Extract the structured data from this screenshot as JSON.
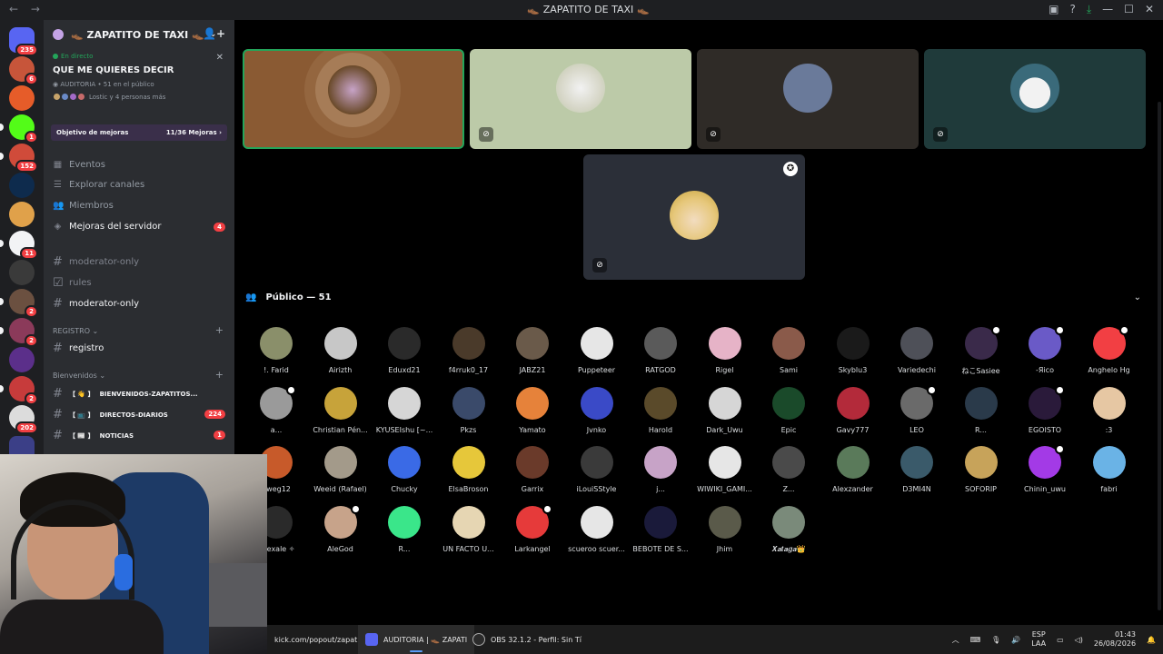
{
  "window": {
    "title": "ZAPATITO DE TAXI",
    "back": "←",
    "forward": "→"
  },
  "rail": {
    "servers": [
      {
        "name": "discord-home",
        "color": "#5865f2",
        "badge": "235"
      },
      {
        "name": "server-2",
        "color": "#c7553a",
        "badge": "6"
      },
      {
        "name": "server-3",
        "color": "#e65c29",
        "badge": ""
      },
      {
        "name": "kick",
        "color": "#53fc18",
        "badge": "1"
      },
      {
        "name": "server-5",
        "color": "#d04b3a",
        "badge": "152"
      },
      {
        "name": "hp-esports",
        "color": "#0e2b4d",
        "badge": ""
      },
      {
        "name": "server-7",
        "color": "#e0a14a",
        "badge": ""
      },
      {
        "name": "server-8",
        "color": "#f2f3f5",
        "badge": "11"
      },
      {
        "name": "server-9",
        "color": "#3a3a3a",
        "badge": ""
      },
      {
        "name": "server-10",
        "color": "#6b5040",
        "badge": "2"
      },
      {
        "name": "server-11",
        "color": "#8b3a5a",
        "badge": "2"
      },
      {
        "name": "server-12",
        "color": "#5b2f8a",
        "badge": ""
      },
      {
        "name": "server-13",
        "color": "#c73b3b",
        "badge": "2"
      },
      {
        "name": "server-14",
        "color": "#dcdcdc",
        "badge": "202"
      },
      {
        "name": "folder",
        "color": "#3b3f87",
        "badge": ""
      }
    ]
  },
  "sidebar": {
    "server_name": "ZAPATITO DE TAXI",
    "live": {
      "tag": "En directo",
      "title": "QUE ME QUIERES DECIR",
      "meta": "AUDITORIA • 51 en el público",
      "people": "Lostic y 4 personas más"
    },
    "boost": {
      "label": "Objetivo de mejoras",
      "progress": "11/36 Mejoras"
    },
    "nav": [
      {
        "label": "Eventos",
        "icon": "calendar-icon"
      },
      {
        "label": "Explorar canales",
        "icon": "explore-icon"
      },
      {
        "label": "Miembros",
        "icon": "members-icon"
      },
      {
        "label": "Mejoras del servidor",
        "icon": "boost-icon",
        "badge": "4"
      }
    ],
    "channels_top": [
      {
        "label": "moderator-only"
      },
      {
        "label": "rules"
      },
      {
        "label": "moderator-only"
      }
    ],
    "category_registro": "REGISTRO",
    "channel_registro": "registro",
    "category_bienvenidos": "Bienvenidos",
    "channels_bottom": [
      {
        "prefix": "【 👋 】",
        "label": "BIENVENIDOS-ZAPATITOS...",
        "badge": ""
      },
      {
        "prefix": "【 📺 】",
        "label": "DIRECTOS-DIARIOS",
        "badge": "224"
      },
      {
        "prefix": "【 📰 】",
        "label": "NOTICIAS",
        "badge": "1"
      }
    ]
  },
  "audience": {
    "title": "Público — 51",
    "members": [
      {
        "name": "!. Farid",
        "color": "#8a8f6a"
      },
      {
        "name": "Airizth",
        "color": "#c7c7c7"
      },
      {
        "name": "Eduxd21",
        "color": "#2a2a2a"
      },
      {
        "name": "f4rruk0_17",
        "color": "#4a3a2a"
      },
      {
        "name": "JABZ21",
        "color": "#6a5a4a"
      },
      {
        "name": "Puppeteer",
        "color": "#e6e6e6"
      },
      {
        "name": "RATGOD",
        "color": "#5a5a5a"
      },
      {
        "name": "Rigel",
        "color": "#e6b3c7"
      },
      {
        "name": "Sami",
        "color": "#8a5a4a"
      },
      {
        "name": "Skyblu3",
        "color": "#1a1a1a"
      },
      {
        "name": "Variedechi",
        "color": "#4e5058"
      },
      {
        "name": "ねこSasiee",
        "color": "#3a2a4a"
      },
      {
        "name": "-Яico",
        "color": "#6a5ac7"
      },
      {
        "name": "Anghelo Hg",
        "color": "#f23f43"
      },
      {
        "name": "a...",
        "color": "#9a9a9a"
      },
      {
        "name": "Christian Pén...",
        "color": "#c7a33a"
      },
      {
        "name": "KYUSEIshu [~...",
        "color": "#d6d6d6"
      },
      {
        "name": "Pkzs",
        "color": "#3a4a6a"
      },
      {
        "name": "Yamato",
        "color": "#e6823a"
      },
      {
        "name": "Jvnko",
        "color": "#3a4ac7"
      },
      {
        "name": "Harold",
        "color": "#5a4a2a"
      },
      {
        "name": "Dark_Uwu",
        "color": "#d6d6d6"
      },
      {
        "name": "Epic",
        "color": "#1a4a2a"
      },
      {
        "name": "Gavy777",
        "color": "#b32a3a"
      },
      {
        "name": "LEO",
        "color": "#6a6a6a"
      },
      {
        "name": "R...",
        "color": "#2a3a4a"
      },
      {
        "name": "EGOISTO",
        "color": "#2a1a3a"
      },
      {
        "name": ":3",
        "color": "#e6c7a3"
      },
      {
        "name": "gweg12",
        "color": "#c75a2a"
      },
      {
        "name": "Weeid (Rafael)",
        "color": "#a39a8a"
      },
      {
        "name": "Chucky",
        "color": "#3a6ae6"
      },
      {
        "name": "ElsaBroson",
        "color": "#e6c73a"
      },
      {
        "name": "Garrix",
        "color": "#6a3a2a"
      },
      {
        "name": "iLouiSStyle",
        "color": "#3a3a3a"
      },
      {
        "name": "j...",
        "color": "#c7a3c7"
      },
      {
        "name": "WIWIKI_GAMI...",
        "color": "#e6e6e6"
      },
      {
        "name": "Z...",
        "color": "#4a4a4a"
      },
      {
        "name": "Alexzander",
        "color": "#5a7a5a"
      },
      {
        "name": "D3MI4N",
        "color": "#3a5a6a"
      },
      {
        "name": "SOFORIP",
        "color": "#c7a35a"
      },
      {
        "name": "Chinin_uwu",
        "color": "#a33ae6"
      },
      {
        "name": "fabri",
        "color": "#6ab3e6"
      },
      {
        "name": "puexale ✧",
        "color": "#2a2a2a"
      },
      {
        "name": "AleGod",
        "color": "#c7a38a"
      },
      {
        "name": "R...",
        "color": "#3ae68a"
      },
      {
        "name": "UN FACTO U...",
        "color": "#e6d6b3"
      },
      {
        "name": "Larkangel",
        "color": "#e63a3a"
      },
      {
        "name": "scueroo scuer...",
        "color": "#e6e6e6"
      },
      {
        "name": "BEBOTE DE S...",
        "color": "#1a1a3a"
      },
      {
        "name": "Jhim",
        "color": "#5a5a4a"
      },
      {
        "name": "𝑿𝒂𝒕𝒂𝒈𝒂👑",
        "color": "#7a8a7a"
      }
    ]
  },
  "taskbar": {
    "items": [
      {
        "label": "kick.com/popout/zapati",
        "icon": "browser-icon"
      },
      {
        "label": "AUDITORIA | 👞 ZAPATI",
        "icon": "discord-icon"
      },
      {
        "label": "OBS 32.1.2 - Perfil: Sin Tí",
        "icon": "obs-icon"
      }
    ],
    "lang_top": "ESP",
    "lang_bottom": "LAA",
    "time": "01:43",
    "date": "26/08/2026"
  },
  "colors": {
    "accent_green": "#23a55a",
    "badge_red": "#f23f43"
  }
}
